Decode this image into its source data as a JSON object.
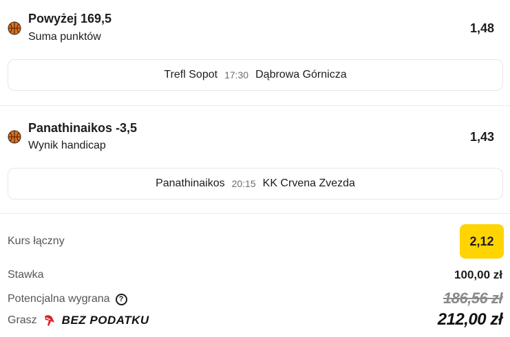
{
  "bets": [
    {
      "icon": "basketball-icon",
      "selection": "Powyżej 169,5",
      "market": "Suma punktów",
      "odds": "1,48",
      "home": "Trefl Sopot",
      "time": "17:30",
      "away": "Dąbrowa Górnicza"
    },
    {
      "icon": "basketball-icon",
      "selection": "Panathinaikos -3,5",
      "market": "Wynik handicap",
      "odds": "1,43",
      "home": "Panathinaikos",
      "time": "20:15",
      "away": "KK Crvena Zvezda"
    }
  ],
  "summary": {
    "total_odds_label": "Kurs łączny",
    "total_odds": "2,12",
    "stake_label": "Stawka",
    "stake": "100,00 zł",
    "potential_label": "Potencjalna wygrana",
    "potential_old": "186,56 zł",
    "grasz_label": "Grasz",
    "tax_badge": "BEZ PODATKU",
    "potential_new": "212,00 zł"
  },
  "colors": {
    "accent": "#ffd400",
    "text": "#1c1c1c",
    "muted": "#555555",
    "basketball": "#e0701c",
    "tax_icon": "#e0202a"
  }
}
